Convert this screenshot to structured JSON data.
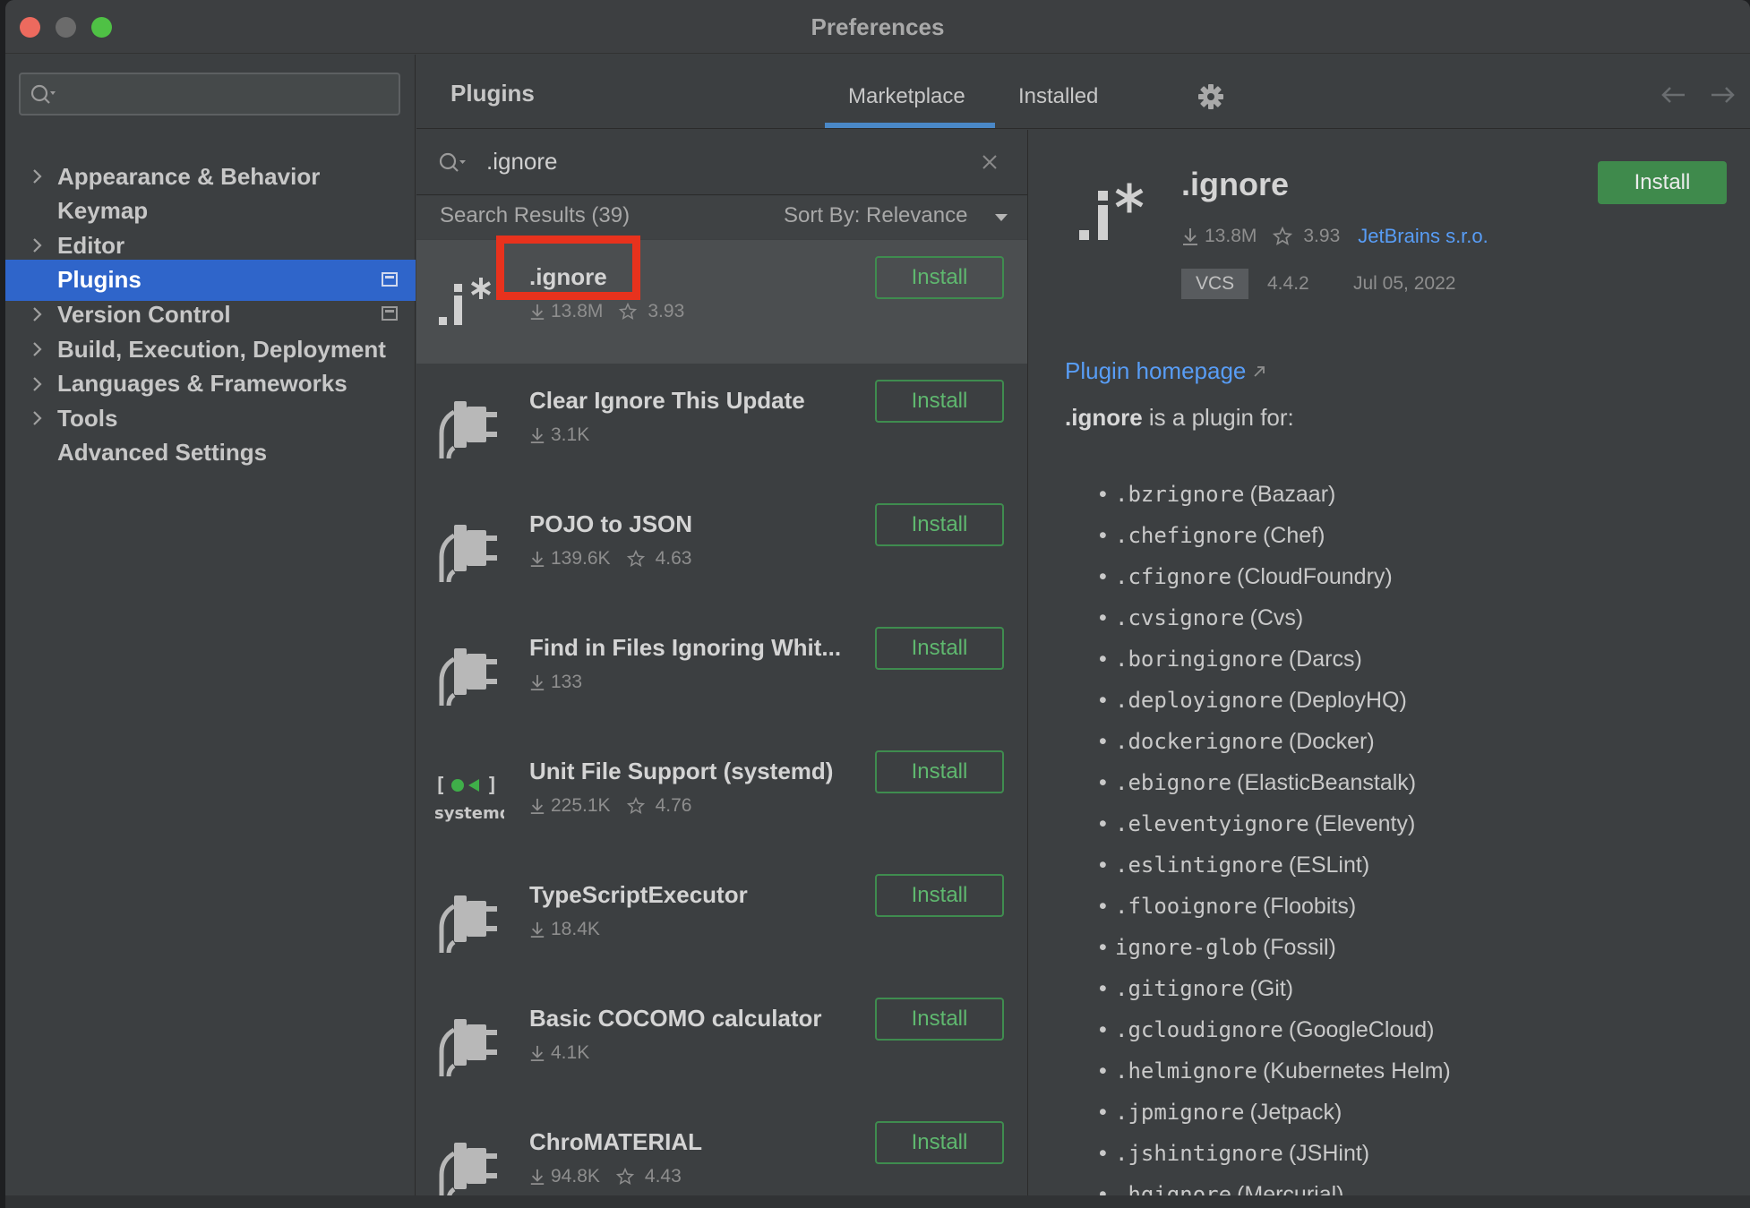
{
  "window": {
    "title": "Preferences"
  },
  "sidebar": {
    "search_placeholder": "",
    "items": [
      {
        "label": "Appearance & Behavior",
        "expandable": true,
        "selected": false,
        "project_icon": false
      },
      {
        "label": "Keymap",
        "expandable": false,
        "selected": false,
        "project_icon": false
      },
      {
        "label": "Editor",
        "expandable": true,
        "selected": false,
        "project_icon": false
      },
      {
        "label": "Plugins",
        "expandable": false,
        "selected": true,
        "project_icon": true
      },
      {
        "label": "Version Control",
        "expandable": true,
        "selected": false,
        "project_icon": true
      },
      {
        "label": "Build, Execution, Deployment",
        "expandable": true,
        "selected": false,
        "project_icon": false
      },
      {
        "label": "Languages & Frameworks",
        "expandable": true,
        "selected": false,
        "project_icon": false
      },
      {
        "label": "Tools",
        "expandable": true,
        "selected": false,
        "project_icon": false
      },
      {
        "label": "Advanced Settings",
        "expandable": false,
        "selected": false,
        "project_icon": false
      }
    ]
  },
  "header": {
    "title": "Plugins",
    "tabs": [
      {
        "label": "Marketplace",
        "active": true
      },
      {
        "label": "Installed",
        "active": false
      }
    ],
    "settings_icon": "gear-icon",
    "back_icon": "arrow-left-icon",
    "forward_icon": "arrow-right-icon"
  },
  "plugin_list": {
    "query": ".ignore",
    "results_label": "Search Results (39)",
    "sort_label": "Sort By: Relevance",
    "install_label": "Install",
    "plugins": [
      {
        "name": ".ignore",
        "downloads": "13.8M",
        "rating": "3.93",
        "icon": "ignore-logo",
        "selected": true
      },
      {
        "name": "Clear Ignore This Update",
        "downloads": "3.1K",
        "rating": "",
        "icon": "plugin-plug-icon",
        "selected": false
      },
      {
        "name": "POJO to JSON",
        "downloads": "139.6K",
        "rating": "4.63",
        "icon": "plugin-plug-icon",
        "selected": false
      },
      {
        "name": "Find in Files Ignoring Whit...",
        "downloads": "133",
        "rating": "",
        "icon": "plugin-plug-icon",
        "selected": false
      },
      {
        "name": "Unit File Support (systemd)",
        "downloads": "225.1K",
        "rating": "4.76",
        "icon": "systemd-logo",
        "selected": false
      },
      {
        "name": "TypeScriptExecutor",
        "downloads": "18.4K",
        "rating": "",
        "icon": "plugin-plug-icon",
        "selected": false
      },
      {
        "name": "Basic COCOMO calculator",
        "downloads": "4.1K",
        "rating": "",
        "icon": "plugin-plug-icon",
        "selected": false
      },
      {
        "name": "ChroMATERIAL",
        "downloads": "94.8K",
        "rating": "4.43",
        "icon": "plugin-plug-icon",
        "selected": false
      }
    ]
  },
  "detail": {
    "name": ".ignore",
    "downloads": "13.8M",
    "rating": "3.93",
    "vendor": "JetBrains s.r.o.",
    "tag": "VCS",
    "version": "4.4.2",
    "date": "Jul 05, 2022",
    "install_label": "Install",
    "homepage_label": "Plugin homepage",
    "intro_name": ".ignore",
    "intro_rest": " is a plugin for:",
    "ignore_files": [
      {
        "file": ".bzrignore",
        "tool": "(Bazaar)"
      },
      {
        "file": ".chefignore",
        "tool": "(Chef)"
      },
      {
        "file": ".cfignore",
        "tool": "(CloudFoundry)"
      },
      {
        "file": ".cvsignore",
        "tool": "(Cvs)"
      },
      {
        "file": ".boringignore",
        "tool": "(Darcs)"
      },
      {
        "file": ".deployignore",
        "tool": "(DeployHQ)"
      },
      {
        "file": ".dockerignore",
        "tool": "(Docker)"
      },
      {
        "file": ".ebignore",
        "tool": "(ElasticBeanstalk)"
      },
      {
        "file": ".eleventyignore",
        "tool": "(Eleventy)"
      },
      {
        "file": ".eslintignore",
        "tool": "(ESLint)"
      },
      {
        "file": ".flooignore",
        "tool": "(Floobits)"
      },
      {
        "file": "ignore-glob",
        "tool": "(Fossil)"
      },
      {
        "file": ".gitignore",
        "tool": "(Git)"
      },
      {
        "file": ".gcloudignore",
        "tool": "(GoogleCloud)"
      },
      {
        "file": ".helmignore",
        "tool": "(Kubernetes Helm)"
      },
      {
        "file": ".jpmignore",
        "tool": "(Jetpack)"
      },
      {
        "file": ".jshintignore",
        "tool": "(JSHint)"
      },
      {
        "file": ".hgignore",
        "tool": "(Mercurial)"
      }
    ]
  },
  "colors": {
    "selection": "#2f65ca",
    "install_green": "#3f8a4c",
    "link_blue": "#589df6",
    "highlight_red": "#e8321d"
  }
}
